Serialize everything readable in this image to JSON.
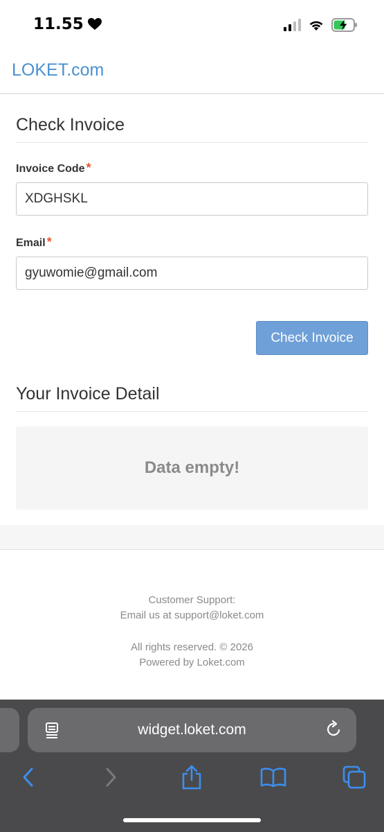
{
  "status_bar": {
    "time": "11.55"
  },
  "header": {
    "brand": "LOKET.com"
  },
  "form": {
    "title": "Check Invoice",
    "invoice_code_label": "Invoice Code",
    "invoice_code_value": "XDGHSKL",
    "email_label": "Email",
    "email_value": "gyuwomie@gmail.com",
    "required_mark": "*",
    "submit_label": "Check Invoice"
  },
  "detail": {
    "title": "Your Invoice Detail",
    "empty_message": "Data empty!"
  },
  "footer": {
    "support_heading": "Customer Support:",
    "support_email_line": "Email us at support@loket.com",
    "rights": "All rights reserved. © 2026",
    "powered": "Powered by Loket.com"
  },
  "browser": {
    "url": "widget.loket.com"
  },
  "colors": {
    "brand": "#4a90d0",
    "button": "#6fa0d8",
    "required": "#e8572f",
    "safari_icon": "#3b8ff0"
  }
}
